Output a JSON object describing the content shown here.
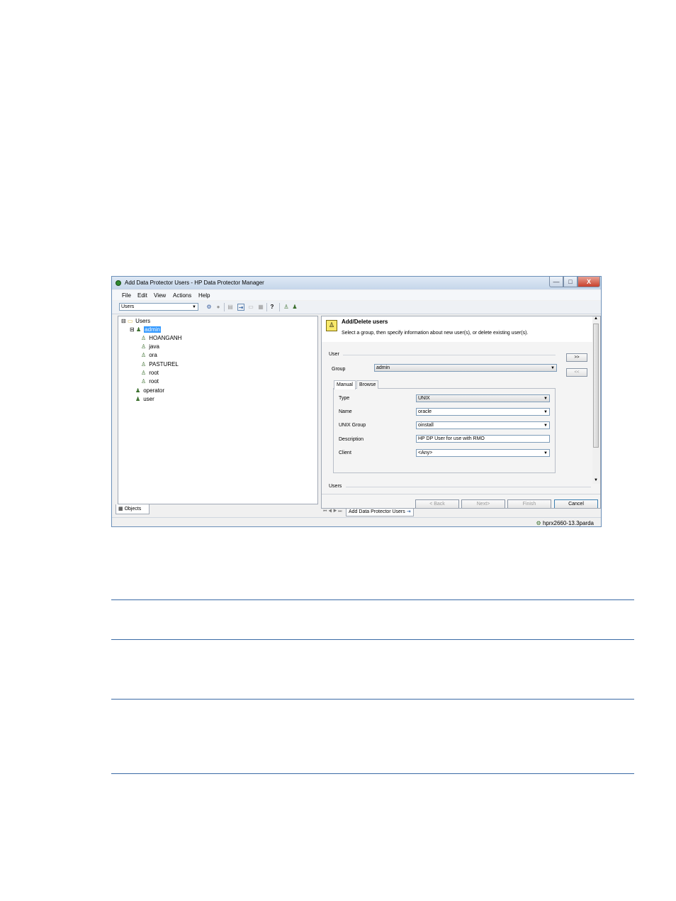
{
  "window": {
    "title": "Add Data Protector Users - HP Data Protector Manager",
    "controls": {
      "minimize": "—",
      "maximize": "□",
      "close": "X"
    }
  },
  "menu": [
    "File",
    "Edit",
    "View",
    "Actions",
    "Help"
  ],
  "toolbar": {
    "context": "Users",
    "help_glyph": "?"
  },
  "tree": {
    "root": "Users",
    "groups": [
      {
        "name": "admin",
        "selected": true,
        "users": [
          "HOANGANH",
          "java",
          "ora",
          "PASTUREL",
          "root",
          "root"
        ]
      },
      {
        "name": "operator"
      },
      {
        "name": "user"
      }
    ]
  },
  "left_tab": "Objects",
  "wizard": {
    "title": "Add/Delete users",
    "subtitle": "Select a group, then specify information about new user(s), or delete existing user(s).",
    "user_section": "User",
    "group_label": "Group",
    "group_value": "admin",
    "tabs": [
      "Manual",
      "Browse"
    ],
    "fields": {
      "type_label": "Type",
      "type_value": "UNIX",
      "name_label": "Name",
      "name_value": "oracle",
      "unix_group_label": "UNIX Group",
      "unix_group_value": "oinstall",
      "description_label": "Description",
      "description_value": "HP DP User for use with RMO",
      "client_label": "Client",
      "client_value": "<Any>"
    },
    "add_button": ">>",
    "remove_button": "<<",
    "users_section": "Users",
    "buttons": {
      "back": "< Back",
      "next": "Next>",
      "finish": "Finish",
      "cancel": "Cancel"
    }
  },
  "bottom_tab": "Add Data Protector Users",
  "status": "hprx2660-13.3parda"
}
